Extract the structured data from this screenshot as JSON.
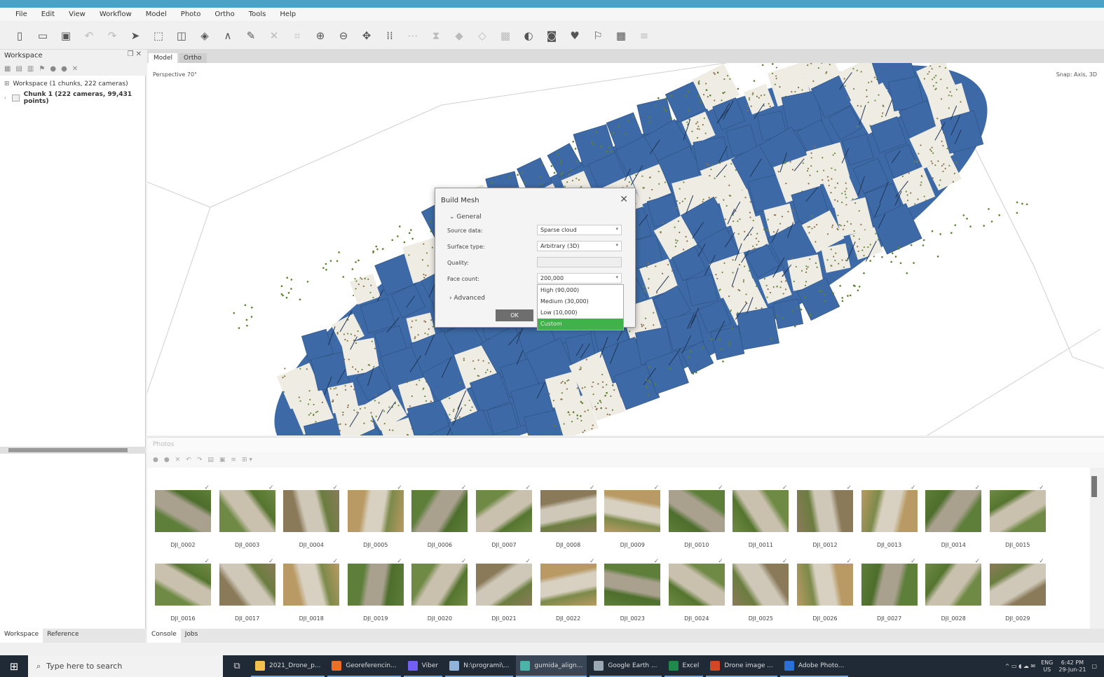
{
  "menu": [
    "File",
    "Edit",
    "View",
    "Workflow",
    "Model",
    "Photo",
    "Ortho",
    "Tools",
    "Help"
  ],
  "toolbar_icons": [
    "new-icon",
    "open-icon",
    "save-icon",
    "undo-icon",
    "redo-icon",
    "pointer-icon",
    "rect-select-icon",
    "circle-select-icon",
    "free-select-icon",
    "ruler-icon",
    "eraser-icon",
    "delete-icon",
    "crop-icon",
    "zoom-in-icon",
    "zoom-out-icon",
    "move-icon",
    "camera-grid-icon",
    "grid-icon",
    "mesh-icon",
    "tie-icon",
    "marker-icon",
    "region-icon",
    "sphere-icon",
    "capture-icon",
    "shield-icon",
    "flag-icon",
    "photo-icon",
    "scale-icon"
  ],
  "workspace": {
    "title": "Workspace",
    "root": "Workspace (1 chunks, 222 cameras)",
    "chunk": "Chunk 1 (222 cameras, 99,431 points)"
  },
  "left_tabs": [
    "Workspace",
    "Reference"
  ],
  "view_tabs": [
    "Model",
    "Ortho"
  ],
  "viewport": {
    "perspective": "Perspective 70°",
    "snap": "Snap: Axis, 3D",
    "cloud_color": "#3d6aa6"
  },
  "dialog": {
    "title": "Build Mesh",
    "general": "General",
    "source_label": "Source data:",
    "source_value": "Sparse cloud",
    "surface_label": "Surface type:",
    "surface_value": "Arbitrary (3D)",
    "quality_label": "Quality:",
    "quality_value": "",
    "face_label": "Face count:",
    "face_value": "200,000",
    "advanced": "Advanced",
    "ok": "OK",
    "options": [
      "High (90,000)",
      "Medium (30,000)",
      "Low (10,000)",
      "Custom"
    ]
  },
  "photos": {
    "title": "Photos",
    "row1": [
      "DJI_0002",
      "DJI_0003",
      "DJI_0004",
      "DJI_0005",
      "DJI_0006",
      "DJI_0007",
      "DJI_0008",
      "DJI_0009",
      "DJI_0010",
      "DJI_0011",
      "DJI_0012",
      "DJI_0013",
      "DJI_0014",
      "DJI_0015"
    ],
    "row2": [
      "DJI_0016",
      "DJI_0017",
      "DJI_0018",
      "DJI_0019",
      "DJI_0020",
      "DJI_0021",
      "DJI_0022",
      "DJI_0023",
      "DJI_0024",
      "DJI_0025",
      "DJI_0026",
      "DJI_0027",
      "DJI_0028",
      "DJI_0029"
    ]
  },
  "bottom_tabs": [
    "Console",
    "Jobs"
  ],
  "taskbar": {
    "search": "Type here to search",
    "apps": [
      {
        "label": "2021_Drone_p...",
        "color": "#f2c14e",
        "active": false
      },
      {
        "label": "Georeferencin...",
        "color": "#e8702a",
        "active": false
      },
      {
        "label": "Viber",
        "color": "#7360f2",
        "active": false
      },
      {
        "label": "N:\\programi\\...",
        "color": "#8fb3d9",
        "active": false
      },
      {
        "label": "gumida_align...",
        "color": "#4bb3a7",
        "active": true
      },
      {
        "label": "Google Earth ...",
        "color": "#9aa7b4",
        "active": false
      },
      {
        "label": "Excel",
        "color": "#1f8a4c",
        "active": false
      },
      {
        "label": "Drone image ...",
        "color": "#d24726",
        "active": false
      },
      {
        "label": "Adobe Photo...",
        "color": "#2d6fd8",
        "active": false
      }
    ],
    "lang": "ENG",
    "region": "US",
    "time": "6:42 PM",
    "date": "29-Jun-21"
  }
}
